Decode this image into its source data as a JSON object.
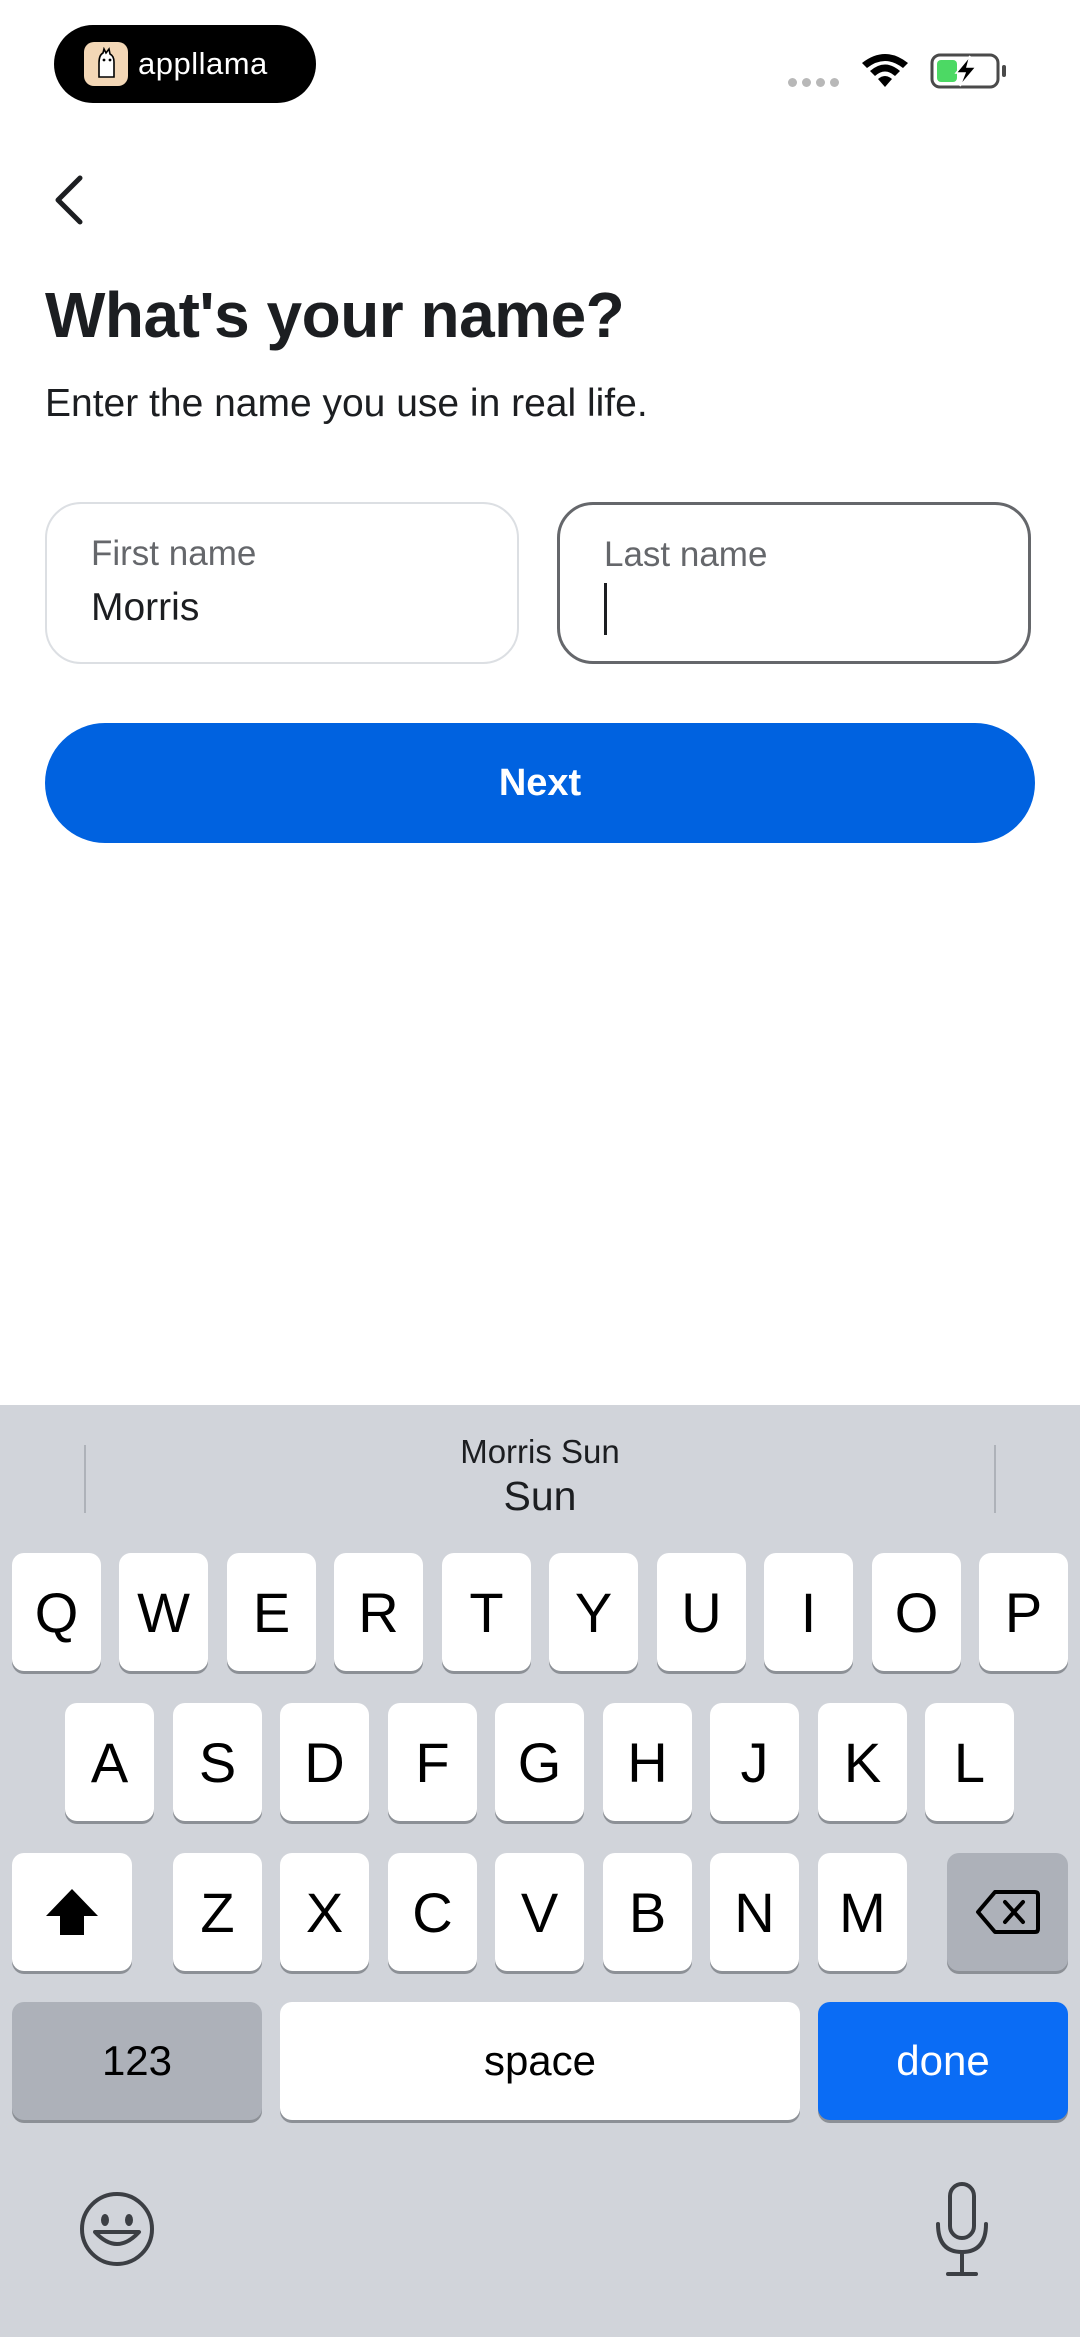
{
  "status_bar": {
    "brand_name": "appllama",
    "icons": [
      "signal-dots",
      "wifi-icon",
      "battery-charging-icon"
    ],
    "battery_color": "#4cd964"
  },
  "nav": {
    "back_icon": "chevron-left-icon"
  },
  "page": {
    "title": "What's your name?",
    "subtitle": "Enter the name you use in real life."
  },
  "form": {
    "first_name": {
      "label": "First name",
      "value": "Morris"
    },
    "last_name": {
      "label": "Last name",
      "value": ""
    },
    "next_label": "Next"
  },
  "keyboard": {
    "prediction": {
      "secondary": "Morris Sun",
      "primary": "Sun"
    },
    "row1": [
      "Q",
      "W",
      "E",
      "R",
      "T",
      "Y",
      "U",
      "I",
      "O",
      "P"
    ],
    "row2": [
      "A",
      "S",
      "D",
      "F",
      "G",
      "H",
      "J",
      "K",
      "L"
    ],
    "row3": [
      "Z",
      "X",
      "C",
      "V",
      "B",
      "N",
      "M"
    ],
    "numbers_label": "123",
    "space_label": "space",
    "done_label": "done",
    "icons": [
      "shift-icon",
      "backspace-icon",
      "emoji-icon",
      "microphone-icon"
    ],
    "accent_color": "#0a6cf5"
  },
  "colors": {
    "primary_button": "#0062e0",
    "text": "#1c1e21",
    "muted_text": "#65676b"
  }
}
